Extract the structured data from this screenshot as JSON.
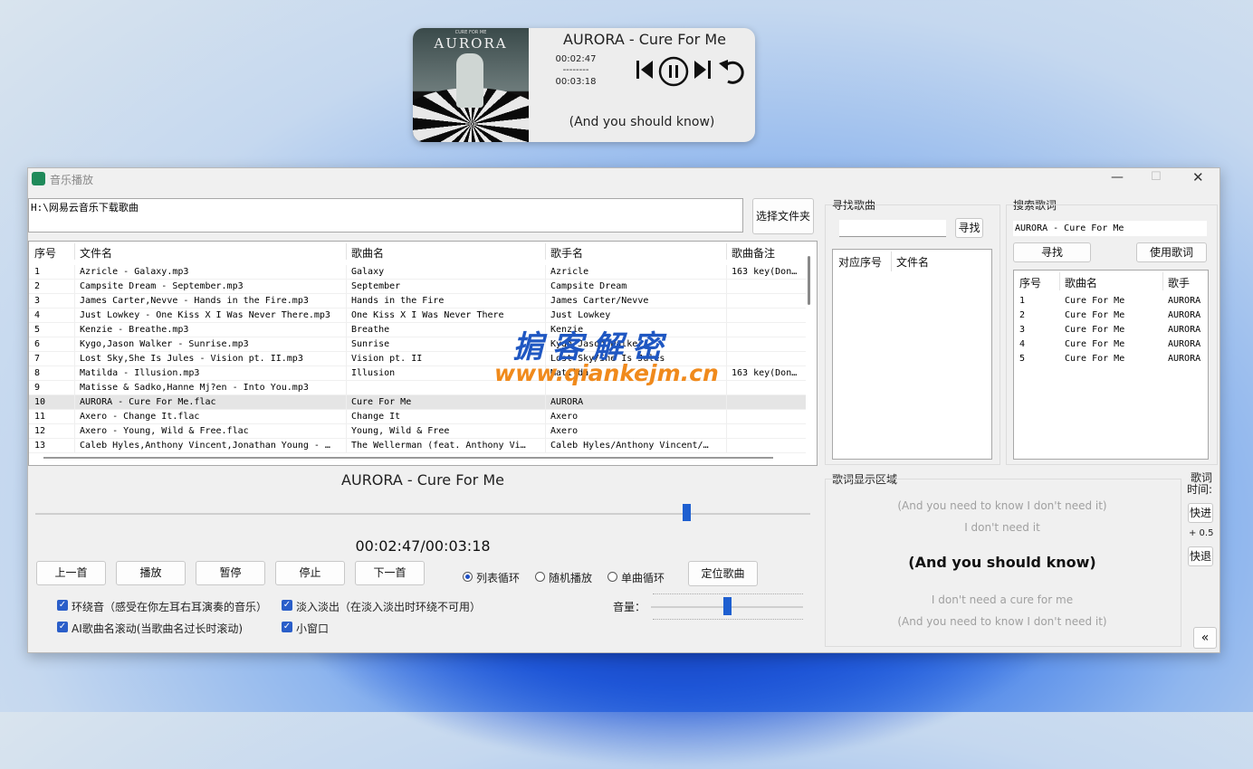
{
  "mini_player": {
    "album_art_text": "AURORA",
    "album_art_small": "CURE FOR ME",
    "title": "AURORA - Cure For Me",
    "current_time": "00:02:47",
    "separator": "--------",
    "total_time": "00:03:18",
    "lyric": "(And you should know)",
    "icons": [
      "previous-icon",
      "pause-icon",
      "next-icon",
      "repeat-icon"
    ]
  },
  "window": {
    "title": "音乐播放",
    "folder_path": "H:\\网易云音乐下载歌曲",
    "select_folder_label": "选择文件夹"
  },
  "song_table": {
    "headers": [
      "序号",
      "文件名",
      "歌曲名",
      "歌手名",
      "歌曲备注"
    ],
    "rows": [
      [
        "1",
        "Azricle - Galaxy.mp3",
        "Galaxy",
        "Azricle",
        "163 key(Don…"
      ],
      [
        "2",
        "Campsite Dream - September.mp3",
        "September",
        "Campsite Dream",
        ""
      ],
      [
        "3",
        "James Carter,Nevve - Hands in the Fire.mp3",
        "Hands in the Fire",
        "James Carter/Nevve",
        ""
      ],
      [
        "4",
        "Just Lowkey - One Kiss X I Was Never There.mp3",
        "One Kiss X I Was Never There",
        "Just Lowkey",
        ""
      ],
      [
        "5",
        "Kenzie - Breathe.mp3",
        "Breathe",
        "Kenzie",
        ""
      ],
      [
        "6",
        "Kygo,Jason Walker - Sunrise.mp3",
        "Sunrise",
        "Kygo/Jason Walker",
        ""
      ],
      [
        "7",
        "Lost Sky,She Is Jules - Vision pt. II.mp3",
        "Vision pt. II",
        "Lost Sky/She Is Jules",
        ""
      ],
      [
        "8",
        "Matilda - Illusion.mp3",
        "Illusion",
        "Matilda",
        "163 key(Don…"
      ],
      [
        "9",
        "Matisse & Sadko,Hanne Mj?en - Into You.mp3",
        "",
        "",
        ""
      ],
      [
        "10",
        "AURORA - Cure For Me.flac",
        "Cure For Me",
        "AURORA",
        ""
      ],
      [
        "11",
        "Axero - Change It.flac",
        "Change It",
        "Axero",
        ""
      ],
      [
        "12",
        "Axero - Young, Wild & Free.flac",
        "Young, Wild & Free",
        "Axero",
        ""
      ],
      [
        "13",
        "Caleb Hyles,Anthony Vincent,Jonathan Young - …",
        "The Wellerman (feat. Anthony Vi…",
        "Caleb Hyles/Anthony Vincent/…",
        ""
      ]
    ],
    "selected_row": 10
  },
  "player": {
    "now_playing": "AURORA - Cure For Me",
    "time_display": "00:02:47/00:03:18",
    "progress": 0.84,
    "buttons": [
      "上一首",
      "播放",
      "暂停",
      "停止",
      "下一首"
    ],
    "modes": [
      "列表循环",
      "随机播放",
      "单曲循环"
    ],
    "selected_mode": "列表循环",
    "locate_label": "定位歌曲",
    "volume_label": "音量：",
    "volume": 0.5,
    "options": [
      {
        "label": "环绕音（感受在你左耳右耳演奏的音乐）",
        "checked": true
      },
      {
        "label": "淡入淡出（在淡入淡出时环绕不可用）",
        "checked": true
      },
      {
        "label": "AI歌曲名滚动(当歌曲名过长时滚动)",
        "checked": true
      },
      {
        "label": "小窗口",
        "checked": true
      }
    ]
  },
  "find_song": {
    "title": "寻找歌曲",
    "search_value": "",
    "search_label": "寻找",
    "headers": [
      "对应序号",
      "文件名"
    ]
  },
  "lyrics_search": {
    "title": "搜索歌词",
    "query": "AURORA - Cure For Me",
    "search_label": "寻找",
    "use_label": "使用歌词",
    "headers": [
      "序号",
      "歌曲名",
      "歌手"
    ],
    "rows": [
      [
        "1",
        "Cure For Me",
        "AURORA"
      ],
      [
        "2",
        "Cure For Me",
        "AURORA"
      ],
      [
        "3",
        "Cure For Me",
        "AURORA"
      ],
      [
        "4",
        "Cure For Me",
        "AURORA"
      ],
      [
        "5",
        "Cure For Me",
        "AURORA"
      ]
    ]
  },
  "lyrics_display": {
    "title": "歌词显示区域",
    "lines": [
      "(And you need to know I don't need it)",
      "I don't need it",
      "(And you should know)",
      "I don't need a cure for me",
      "(And you need to know I don't need it)"
    ],
    "current_index": 2,
    "time_label_1": "歌词",
    "time_label_2": "时间:",
    "forward_label": "快进",
    "offset": "+ 0.5",
    "rewind_label": "快退",
    "collapse_label": "«"
  },
  "watermark": {
    "line1": "掮客解密",
    "line2": "www.qiankejm.cn"
  },
  "colors": {
    "accent": "#1e5fd0",
    "checkbox": "#2a5ec9",
    "watermark_blue": "#1f57c2",
    "watermark_orange": "#f08a1c"
  }
}
